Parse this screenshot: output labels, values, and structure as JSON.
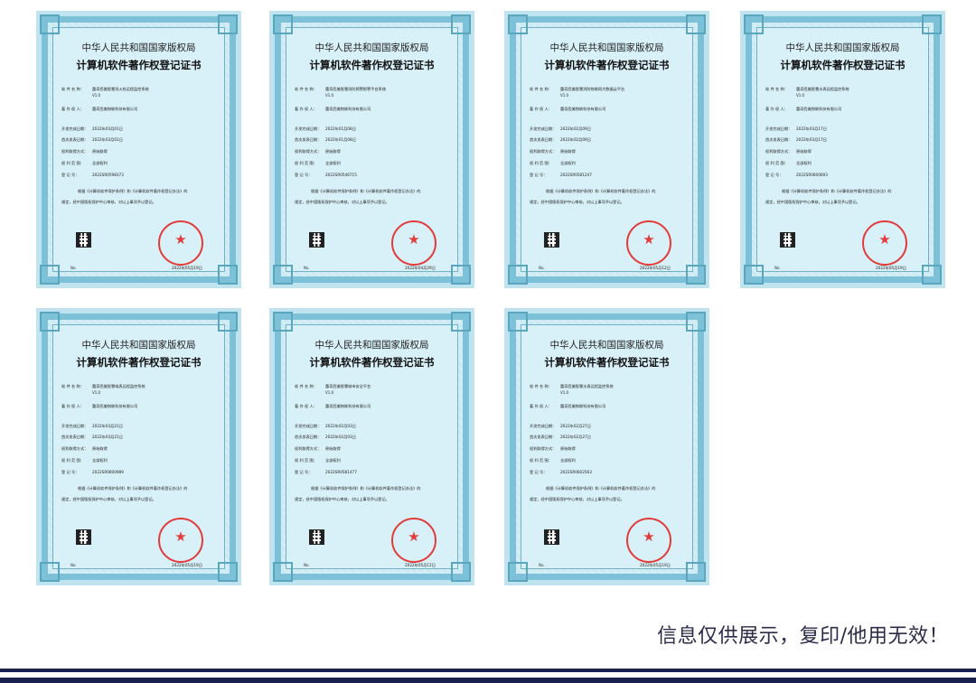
{
  "common": {
    "header1": "中华人民共和国国家版权局",
    "header2": "计算机软件著作权登记证书",
    "label_name": "软 件 名 称：",
    "label_owner": "著 作 权 人：",
    "label_dev": "开发完成日期：",
    "label_pub": "首次发表日期：",
    "label_method": "权利取得方式：",
    "label_scope": "权 利 范 围：",
    "label_reg": "登 记 号：",
    "method": "原始取得",
    "scope": "全部权利",
    "version": "V1.0",
    "owner": "蕾奇西美物联科技有限公司",
    "para1": "根据《计算机软件保护条例》和《计算机软件著作权登记办法》的",
    "para2": "规定，经中国版权保护中心审核，对以上事项予以登记。",
    "no_label": "No.",
    "seal_star": "★"
  },
  "certificates": [
    {
      "name": "蕾奇西美智慧消火栓远程监控系统",
      "dev": "2022年03月01日",
      "pub": "2022年03月01日",
      "reg": "2022SR0598373",
      "date": "2022年05月19日"
    },
    {
      "name": "蕾奇西美智慧消防预警报警平台系统",
      "dev": "2022年01月08日",
      "pub": "2022年01月08日",
      "reg": "2022SR0546715",
      "date": "2022年04月29日"
    },
    {
      "name": "蕾奇西美智慧消防物联网大数据云平台",
      "dev": "2022年02月09日",
      "pub": "2022年02月09日",
      "reg": "2022SR0581247",
      "date": "2022年05月12日"
    },
    {
      "name": "蕾奇西美智慧水表远程监控系统",
      "dev": "2022年03月17日",
      "pub": "2022年03月17日",
      "reg": "2022SR0600693",
      "date": "2022年05月19日"
    },
    {
      "name": "蕾奇西美智慧电表远程监控系统",
      "dev": "2022年03月21日",
      "pub": "2022年03月21日",
      "reg": "2022SR0600989",
      "date": "2022年05月19日"
    },
    {
      "name": "蕾奇西美智慧城市安全平台",
      "dev": "2022年02月03日",
      "pub": "2022年02月03日",
      "reg": "2022SR0581477",
      "date": "2022年05月12日"
    },
    {
      "name": "蕾奇西美智慧水表远程监控系统",
      "dev": "2022年02月27日",
      "pub": "2022年02月27日",
      "reg": "2022SR0602563",
      "date": "2022年05月19日"
    }
  ],
  "footer": {
    "disclaimer": "信息仅供展示，复印/他用无效！"
  }
}
